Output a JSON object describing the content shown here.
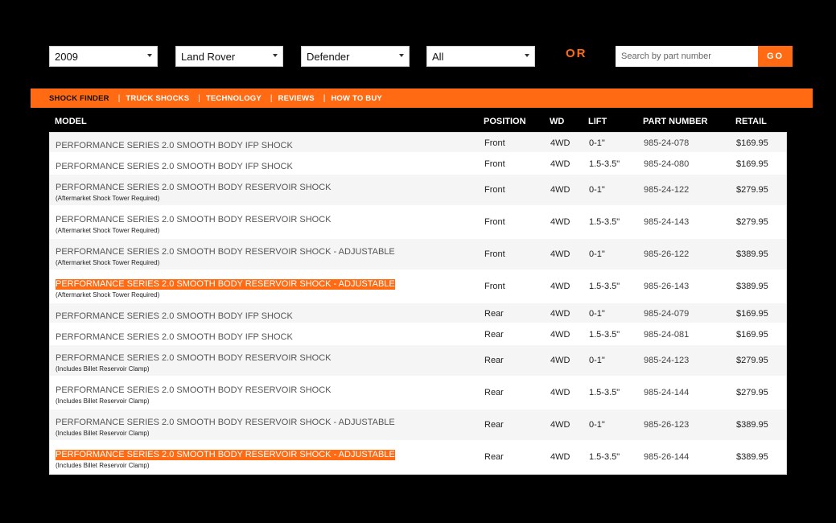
{
  "filters": {
    "year": "2009",
    "make": "Land Rover",
    "model": "Defender",
    "submodel": "All",
    "or_label": "OR",
    "search_placeholder": "Search by part number",
    "go_label": "GO"
  },
  "nav": {
    "items": [
      {
        "label": "SHOCK FINDER",
        "active": true
      },
      {
        "label": "TRUCK SHOCKS",
        "active": false
      },
      {
        "label": "TECHNOLOGY",
        "active": false
      },
      {
        "label": "REVIEWS",
        "active": false
      },
      {
        "label": "HOW TO BUY",
        "active": false
      }
    ]
  },
  "colors": {
    "accent": "#ff6a13",
    "background": "#000000"
  },
  "table": {
    "headers": {
      "model": "MODEL",
      "position": "POSITION",
      "wd": "WD",
      "lift": "LIFT",
      "part_number": "PART NUMBER",
      "retail": "RETAIL"
    },
    "rows": [
      {
        "model": "PERFORMANCE SERIES 2.0 SMOOTH BODY IFP SHOCK",
        "note": "",
        "position": "Front",
        "wd": "4WD",
        "lift": "0-1\"",
        "part": "985-24-078",
        "retail": "$169.95",
        "highlight": false
      },
      {
        "model": "PERFORMANCE SERIES 2.0 SMOOTH BODY IFP SHOCK",
        "note": "",
        "position": "Front",
        "wd": "4WD",
        "lift": "1.5-3.5\"",
        "part": "985-24-080",
        "retail": "$169.95",
        "highlight": false
      },
      {
        "model": "PERFORMANCE SERIES 2.0 SMOOTH BODY RESERVOIR SHOCK",
        "note": "(Aftermarket Shock Tower Required)",
        "position": "Front",
        "wd": "4WD",
        "lift": "0-1\"",
        "part": "985-24-122",
        "retail": "$279.95",
        "highlight": false
      },
      {
        "model": "PERFORMANCE SERIES 2.0 SMOOTH BODY RESERVOIR SHOCK",
        "note": "(Aftermarket Shock Tower Required)",
        "position": "Front",
        "wd": "4WD",
        "lift": "1.5-3.5\"",
        "part": "985-24-143",
        "retail": "$279.95",
        "highlight": false
      },
      {
        "model": "PERFORMANCE SERIES 2.0 SMOOTH BODY RESERVOIR SHOCK - ADJUSTABLE",
        "note": "(Aftermarket Shock Tower Required)",
        "position": "Front",
        "wd": "4WD",
        "lift": "0-1\"",
        "part": "985-26-122",
        "retail": "$389.95",
        "highlight": false
      },
      {
        "model": "PERFORMANCE SERIES 2.0 SMOOTH BODY RESERVOIR SHOCK - ADJUSTABLE",
        "note": "(Aftermarket Shock Tower Required)",
        "position": "Front",
        "wd": "4WD",
        "lift": "1.5-3.5\"",
        "part": "985-26-143",
        "retail": "$389.95",
        "highlight": true
      },
      {
        "model": "PERFORMANCE SERIES 2.0 SMOOTH BODY IFP SHOCK",
        "note": "",
        "position": "Rear",
        "wd": "4WD",
        "lift": "0-1\"",
        "part": "985-24-079",
        "retail": "$169.95",
        "highlight": false
      },
      {
        "model": "PERFORMANCE SERIES 2.0 SMOOTH BODY IFP SHOCK",
        "note": "",
        "position": "Rear",
        "wd": "4WD",
        "lift": "1.5-3.5\"",
        "part": "985-24-081",
        "retail": "$169.95",
        "highlight": false
      },
      {
        "model": "PERFORMANCE SERIES 2.0 SMOOTH BODY RESERVOIR SHOCK",
        "note": "(Includes Billet Reservoir Clamp)",
        "position": "Rear",
        "wd": "4WD",
        "lift": "0-1\"",
        "part": "985-24-123",
        "retail": "$279.95",
        "highlight": false
      },
      {
        "model": "PERFORMANCE SERIES 2.0 SMOOTH BODY RESERVOIR SHOCK",
        "note": "(Includes Billet Reservoir Clamp)",
        "position": "Rear",
        "wd": "4WD",
        "lift": "1.5-3.5\"",
        "part": "985-24-144",
        "retail": "$279.95",
        "highlight": false
      },
      {
        "model": "PERFORMANCE SERIES 2.0 SMOOTH BODY RESERVOIR SHOCK - ADJUSTABLE",
        "note": "(Includes Billet Reservoir Clamp)",
        "position": "Rear",
        "wd": "4WD",
        "lift": "0-1\"",
        "part": "985-26-123",
        "retail": "$389.95",
        "highlight": false
      },
      {
        "model": "PERFORMANCE SERIES 2.0 SMOOTH BODY RESERVOIR SHOCK - ADJUSTABLE",
        "note": "(Includes Billet Reservoir Clamp)",
        "position": "Rear",
        "wd": "4WD",
        "lift": "1.5-3.5\"",
        "part": "985-26-144",
        "retail": "$389.95",
        "highlight": true
      }
    ]
  }
}
